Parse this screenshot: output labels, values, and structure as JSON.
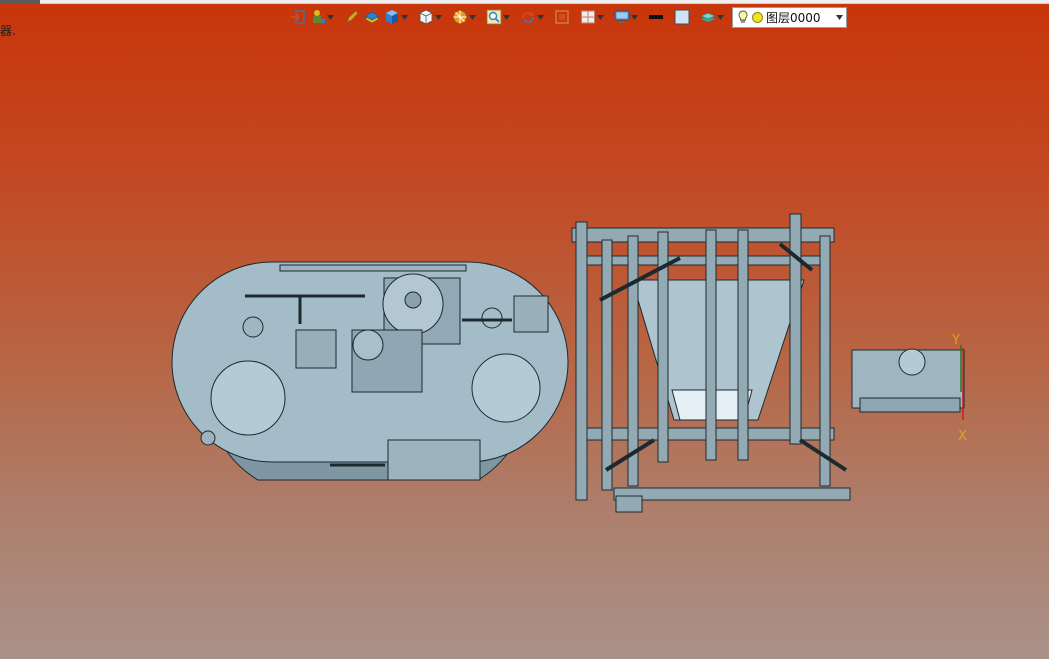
{
  "status": {
    "fragment": "器."
  },
  "toolbar": {
    "items": [
      {
        "name": "exit-icon",
        "color": "#4a6fa5"
      },
      {
        "name": "operator-icon",
        "color": "#5a8a30"
      },
      {
        "name": "pen-icon",
        "color": "#e0a020"
      },
      {
        "name": "material-icon",
        "color": "#e0b820"
      },
      {
        "name": "cube-shaded-icon",
        "color": "#2e7fd0"
      },
      {
        "name": "cube-view-icon",
        "color": "#f4f4f4"
      },
      {
        "name": "section-icon",
        "color": "#e89a20"
      },
      {
        "name": "zoom-icon",
        "color": "#d0a020"
      },
      {
        "name": "rotate-icon",
        "color": "#d04a2a"
      },
      {
        "name": "frame-icon",
        "color": "#d07a2a"
      },
      {
        "name": "split-icon",
        "color": "#c08060"
      },
      {
        "name": "monitor-icon",
        "color": "#4a90c8"
      },
      {
        "name": "line-color-icon",
        "color": "#111111"
      },
      {
        "name": "fill-color-icon",
        "color": "#cde4f5"
      },
      {
        "name": "layer-stack-icon",
        "color": "#3aa8a0"
      }
    ],
    "layer_selector": {
      "value": "图层0000"
    }
  },
  "axes": {
    "y_label": "Y",
    "x_label": "X"
  },
  "colors": {
    "model_fill": "#8fa8b4",
    "model_fill_light": "#b3c8d2",
    "model_stroke": "#1c2a30",
    "frame_fill": "#93aab5"
  }
}
